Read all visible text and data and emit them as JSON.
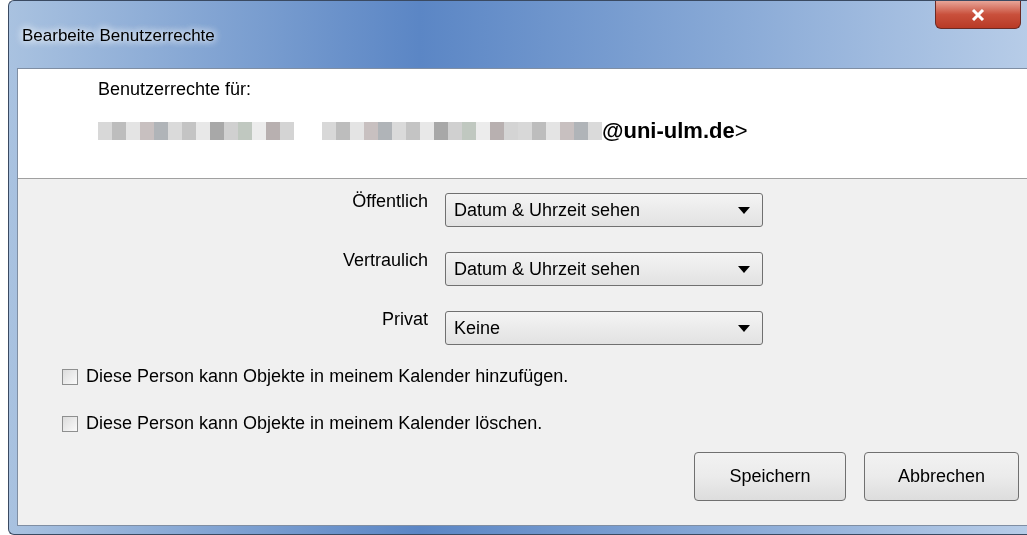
{
  "window": {
    "title": "Bearbeite Benutzerrechte"
  },
  "header": {
    "label": "Benutzerrechte für:",
    "email": "**@uni-ulm.de**>"
  },
  "permissions": [
    {
      "label": "Öffentlich",
      "value": "Datum & Uhrzeit sehen"
    },
    {
      "label": "Vertraulich",
      "value": "Datum & Uhrzeit sehen"
    },
    {
      "label": "Privat",
      "value": "Keine"
    }
  ],
  "options": [
    {
      "label": "Diese Person kann Objekte in meinem Kalender hinzufügen.",
      "checked": false
    },
    {
      "label": "Diese Person kann Objekte in meinem Kalender löschen.",
      "checked": false
    }
  ],
  "buttons": [
    "Speichern",
    "Abbrechen"
  ]
}
